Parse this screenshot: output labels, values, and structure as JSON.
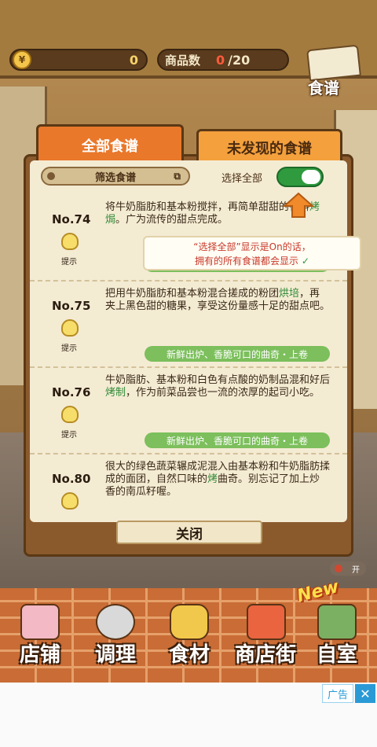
{
  "topbar": {
    "coin_icon_glyph": "¥",
    "coins": "0",
    "item_count_label": "商品数",
    "item_count_current": "0",
    "item_count_total": "/20",
    "recipe_book_label": "食谱"
  },
  "tabs": {
    "all": "全部食谱",
    "undiscovered": "未发现的食谱"
  },
  "filter": {
    "label": "筛选食谱",
    "select_all_label": "选择全部"
  },
  "recipes": [
    {
      "no": "No.74",
      "desc_before": "将牛奶脂肪和基本粉搅拌，再简单",
      "desc_hidden": "",
      "desc_after": "甜甜的香料",
      "highlight": "烤焗",
      "desc_tail": "。广为流传的甜点完成。",
      "hint": "提示",
      "tag": ""
    },
    {
      "no": "No.75",
      "desc_before": "把用牛奶脂肪和基本粉混合搓成的粉团",
      "highlight": "烘培",
      "desc_tail": "，再夹上黑色甜的糖果，享受这份量感十足的甜点吧。",
      "hint": "提示",
      "tag": "新鲜出炉、香脆可口的曲奇・上卷"
    },
    {
      "no": "No.76",
      "desc_before": "牛奶脂肪、基本粉和白色有点酸的奶制品混和好后",
      "highlight": "烤制",
      "desc_tail": "，作为前菜品尝也一流的浓厚的起司小吃。",
      "hint": "提示",
      "tag": "新鲜出炉、香脆可口的曲奇・上卷"
    },
    {
      "no": "No.80",
      "desc_before": "很大的绿色蔬菜辗成泥混入由基本粉和牛奶脂肪揉成的面团，自然口味的",
      "highlight": "烤",
      "desc_tail": "曲奇。别忘记了加上炒香的南瓜籽喔。",
      "hint": "",
      "tag": ""
    }
  ],
  "tooltip": {
    "line1": "“选择全部”显示是On的话，",
    "line2": "拥有的所有食谱都会显示",
    "check": "✓"
  },
  "partial_tag": "上卷",
  "close_label": "关闭",
  "small_toggle_label": "开",
  "bottom_nav": {
    "shop": "店铺",
    "cook": "调理",
    "ingredient": "食材",
    "street": "商店街",
    "room": "自室",
    "new_badge": "New"
  },
  "ad": {
    "label": "广告",
    "close_glyph": "✕"
  },
  "colors": {
    "accent_orange": "#e9782b",
    "highlight_green": "#2e8a35",
    "toggle_green": "#2f9a3e",
    "warning_red": "#c8382a"
  }
}
